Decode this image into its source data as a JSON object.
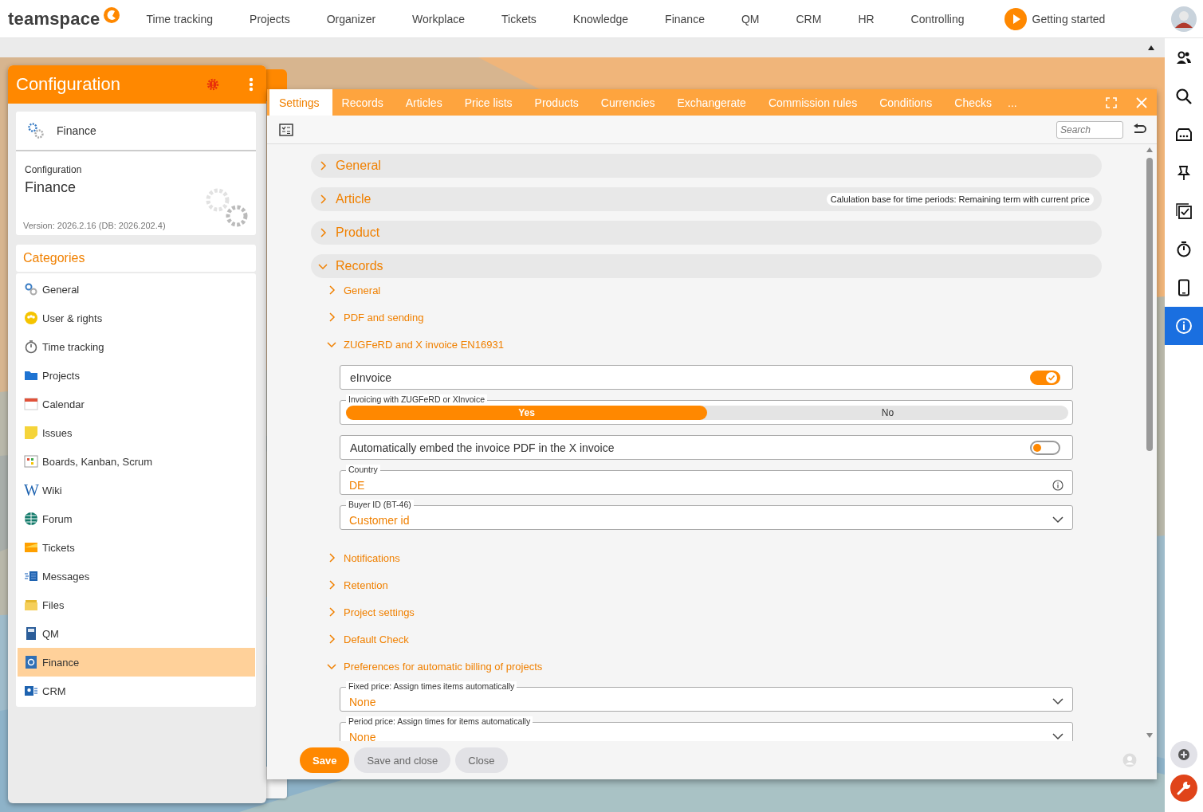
{
  "top_nav": {
    "logo": "teamspace",
    "items": [
      "Time tracking",
      "Projects",
      "Organizer",
      "Workplace",
      "Tickets",
      "Knowledge",
      "Finance",
      "QM",
      "CRM",
      "HR",
      "Controlling"
    ],
    "getting_started": "Getting started"
  },
  "side_bar": [
    {
      "selected": false
    },
    {
      "selected": false
    },
    {
      "selected": false
    },
    {
      "selected": false
    },
    {
      "selected": false
    },
    {
      "selected": false
    },
    {
      "selected": false
    },
    {
      "selected": true
    }
  ],
  "config_panel": {
    "title": "Configuration",
    "module": "Finance",
    "info": {
      "label": "Configuration",
      "title": "Finance",
      "version": "Version: 2026.2.16 (DB: 2026.202.4)"
    },
    "categories_title": "Categories",
    "categories": [
      {
        "label": "General",
        "selected": false
      },
      {
        "label": "User & rights",
        "selected": false
      },
      {
        "label": "Time tracking",
        "selected": false
      },
      {
        "label": "Projects",
        "selected": false
      },
      {
        "label": "Calendar",
        "selected": false
      },
      {
        "label": "Issues",
        "selected": false
      },
      {
        "label": "Boards, Kanban, Scrum",
        "selected": false
      },
      {
        "label": "Wiki",
        "selected": false,
        "glyph": "W"
      },
      {
        "label": "Forum",
        "selected": false
      },
      {
        "label": "Tickets",
        "selected": false
      },
      {
        "label": "Messages",
        "selected": false
      },
      {
        "label": "Files",
        "selected": false
      },
      {
        "label": "QM",
        "selected": false
      },
      {
        "label": "Finance",
        "selected": true
      },
      {
        "label": "CRM",
        "selected": false
      }
    ]
  },
  "dialog": {
    "tabs": [
      {
        "label": "Settings",
        "selected": true
      },
      {
        "label": "Records",
        "selected": false
      },
      {
        "label": "Articles",
        "selected": false
      },
      {
        "label": "Price lists",
        "selected": false
      },
      {
        "label": "Products",
        "selected": false
      },
      {
        "label": "Currencies",
        "selected": false
      },
      {
        "label": "Exchangerate",
        "selected": false
      },
      {
        "label": "Commission rules",
        "selected": false
      },
      {
        "label": "Conditions",
        "selected": false
      },
      {
        "label": "Checks",
        "selected": false
      }
    ],
    "more_tabs": "...",
    "search": {
      "placeholder": "Search"
    },
    "sections": [
      {
        "title": "General",
        "expanded": false
      },
      {
        "title": "Article",
        "expanded": false,
        "note": "Calulation base for time periods: Remaining term with current price"
      },
      {
        "title": "Product",
        "expanded": false
      },
      {
        "title": "Records",
        "expanded": true,
        "children": [
          {
            "title": "General",
            "expanded": false
          },
          {
            "title": "PDF and sending",
            "expanded": false
          },
          {
            "title": "ZUGFeRD and X invoice EN16931",
            "expanded": true,
            "fields": [
              {
                "kind": "toggle",
                "label": "eInvoice",
                "on": true
              },
              {
                "kind": "choice",
                "legend": "Invoicing with ZUGFeRD or XInvoice",
                "options": [
                  {
                    "label": "Yes",
                    "selected": true
                  },
                  {
                    "label": "No",
                    "selected": false
                  }
                ]
              },
              {
                "kind": "toggle",
                "label": "Automatically embed the invoice PDF in the X invoice",
                "on": false
              },
              {
                "kind": "text",
                "legend": "Country",
                "value": "DE"
              },
              {
                "kind": "select",
                "legend": "Buyer ID (BT-46)",
                "value": "Customer id"
              }
            ]
          },
          {
            "title": "Notifications",
            "expanded": false
          },
          {
            "title": "Retention",
            "expanded": false
          },
          {
            "title": "Project settings",
            "expanded": false
          },
          {
            "title": "Default Check",
            "expanded": false
          },
          {
            "title": "Preferences for automatic billing of projects",
            "expanded": true,
            "fields": [
              {
                "kind": "select",
                "legend": "Fixed price: Assign times items automatically",
                "value": "None"
              },
              {
                "kind": "select",
                "legend": "Period price: Assign times for items automatically",
                "value": "None"
              }
            ]
          }
        ]
      }
    ],
    "buttons": [
      {
        "label": "Save",
        "kind": "primary"
      },
      {
        "label": "Save and close",
        "kind": "secondary"
      },
      {
        "label": "Close",
        "kind": "secondary"
      }
    ]
  }
}
